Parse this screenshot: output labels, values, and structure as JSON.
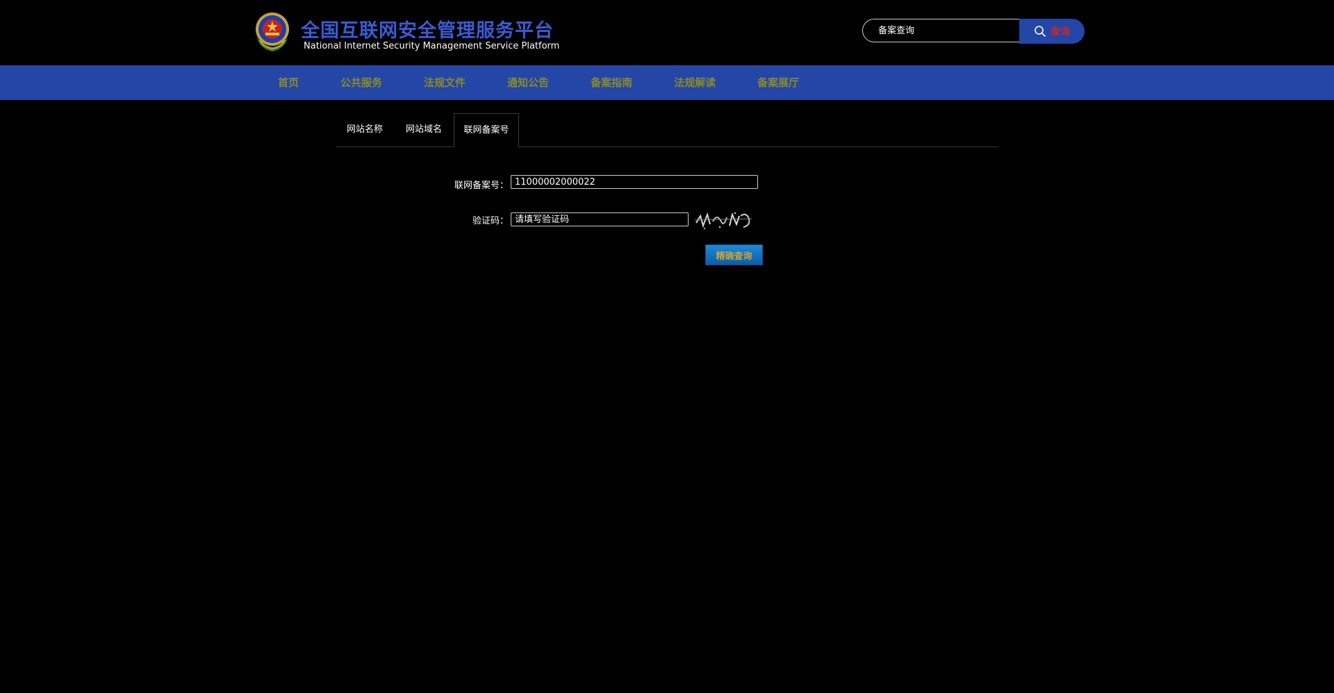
{
  "header": {
    "title": "全国互联网安全管理服务平台",
    "subtitle": "National Internet Security Management Service Platform",
    "emblem_icon": "police-emblem-icon"
  },
  "search": {
    "placeholder": "备案查询",
    "button_label": "查询",
    "icon": "search-icon"
  },
  "nav": {
    "items": [
      {
        "label": "首页"
      },
      {
        "label": "公共服务"
      },
      {
        "label": "法规文件"
      },
      {
        "label": "通知公告"
      },
      {
        "label": "备案指南"
      },
      {
        "label": "法规解读"
      },
      {
        "label": "备案展厅"
      }
    ]
  },
  "tabs": [
    {
      "label": "网站名称"
    },
    {
      "label": "网站域名"
    },
    {
      "label": "联网备案号"
    }
  ],
  "form": {
    "record_label": "联网备案号：",
    "record_value": "11000002000022",
    "captcha_label": "验证码：",
    "captcha_value": "请填写验证码",
    "submit_label": "精确查询"
  },
  "colors": {
    "background": "#000000",
    "nav_background": "#2446a6",
    "title_color": "#3a5bd2",
    "button_gradient_top": "#1d8ad6",
    "button_gradient_bottom": "#0d5ca8"
  }
}
